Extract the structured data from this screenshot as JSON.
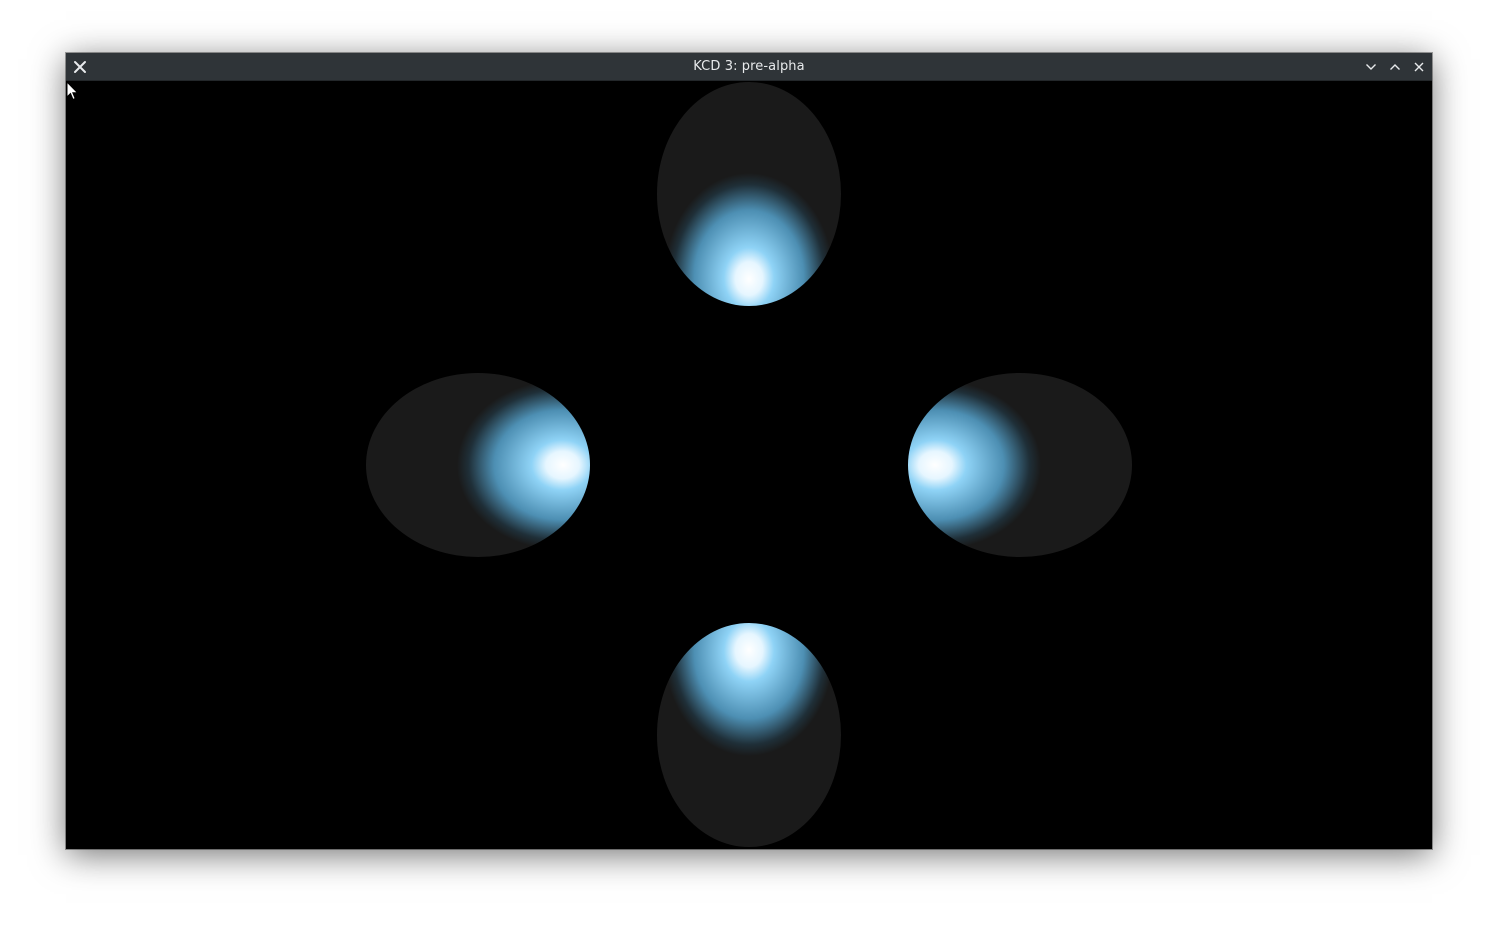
{
  "window": {
    "title": "KCD 3: pre-alpha"
  },
  "titlebar": {
    "icons": {
      "menu": "close-x-icon",
      "minimize": "chevron-down-icon",
      "maximize": "chevron-up-icon",
      "close": "close-icon"
    },
    "background_color": "#2f3438",
    "text_color": "#e8eaec"
  },
  "scene": {
    "background_color": "#000000",
    "sphere_base_color": "#1a1a1a",
    "highlight_color": "#87d0f5",
    "specular_color": "#ffffff",
    "spheres": [
      {
        "name": "sphere-top",
        "lit_side": "bottom"
      },
      {
        "name": "sphere-left",
        "lit_side": "right"
      },
      {
        "name": "sphere-right",
        "lit_side": "left"
      },
      {
        "name": "sphere-bottom",
        "lit_side": "top"
      }
    ]
  },
  "cursor": {
    "icon": "mouse-pointer-icon"
  }
}
